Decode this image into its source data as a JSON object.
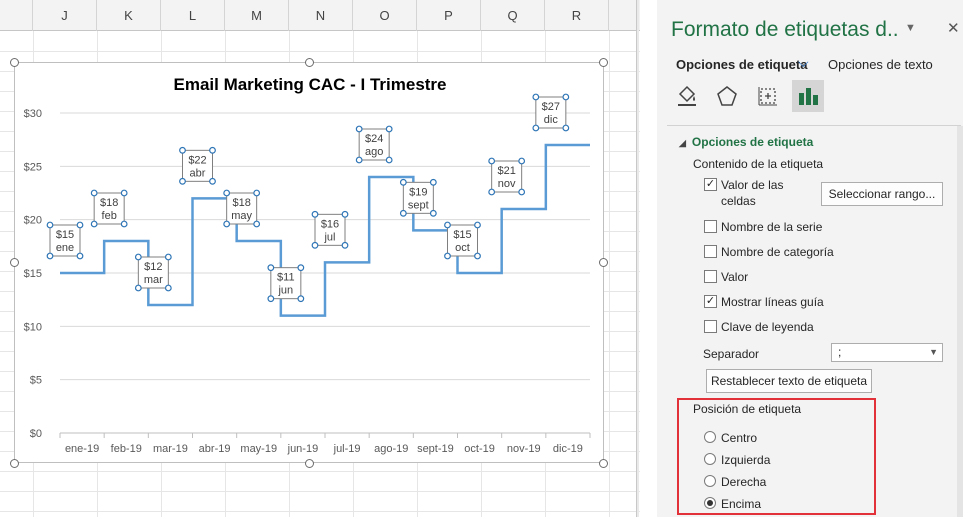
{
  "sheet": {
    "columns": [
      "J",
      "K",
      "L",
      "M",
      "N",
      "O",
      "P",
      "Q",
      "R"
    ]
  },
  "chart_data": {
    "type": "line",
    "title": "Email Marketing CAC - I Trimestre",
    "categories": [
      "ene-19",
      "feb-19",
      "mar-19",
      "abr-19",
      "may-19",
      "jun-19",
      "jul-19",
      "ago-19",
      "sept-19",
      "oct-19",
      "nov-19",
      "dic-19"
    ],
    "values": [
      15,
      18,
      12,
      22,
      18,
      11,
      16,
      24,
      19,
      15,
      21,
      27
    ],
    "data_labels": [
      {
        "value": "$15",
        "month": "ene"
      },
      {
        "value": "$18",
        "month": "feb"
      },
      {
        "value": "$12",
        "month": "mar"
      },
      {
        "value": "$22",
        "month": "abr"
      },
      {
        "value": "$18",
        "month": "may"
      },
      {
        "value": "$11",
        "month": "jun"
      },
      {
        "value": "$16",
        "month": "jul"
      },
      {
        "value": "$24",
        "month": "ago"
      },
      {
        "value": "$19",
        "month": "sept"
      },
      {
        "value": "$15",
        "month": "oct"
      },
      {
        "value": "$21",
        "month": "nov"
      },
      {
        "value": "$27",
        "month": "dic"
      }
    ],
    "yticks": [
      "$0",
      "$5",
      "$10",
      "$15",
      "$20",
      "$25",
      "$30"
    ],
    "ylim": [
      0,
      30
    ],
    "line_style": "step",
    "line_color": "#5b9bd5",
    "grid": true
  },
  "pane": {
    "title": "Formato de etiquetas d..",
    "tab_active": "Opciones de etiqueta",
    "tab_other": "Opciones de texto",
    "section": "Opciones de etiqueta",
    "content_label": "Contenido de la etiqueta",
    "checkboxes": [
      {
        "label": "Valor de las",
        "label2": "celdas",
        "checked": true
      },
      {
        "label": "Nombre de la serie",
        "checked": false
      },
      {
        "label": "Nombre de categoría",
        "checked": false
      },
      {
        "label": "Valor",
        "checked": false
      },
      {
        "label": "Mostrar líneas guía",
        "checked": true
      },
      {
        "label": "Clave de leyenda",
        "checked": false
      }
    ],
    "select_range_button": "Seleccionar rango...",
    "separator_label": "Separador",
    "separator_value": ";",
    "reset_button": "Restablecer texto de etiqueta",
    "position_label": "Posición de etiqueta",
    "positions": [
      {
        "label": "Centro",
        "selected": false
      },
      {
        "label": "Izquierda",
        "selected": false
      },
      {
        "label": "Derecha",
        "selected": false
      },
      {
        "label": "Encima",
        "selected": true
      }
    ],
    "accent_color": "#217346",
    "highlight_color": "#e3313a"
  }
}
